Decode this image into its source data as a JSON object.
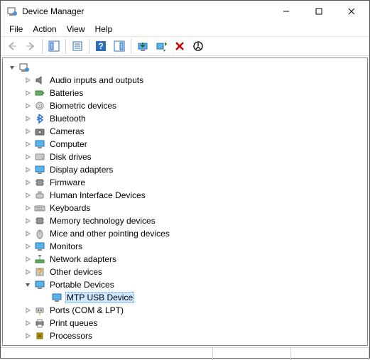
{
  "window": {
    "title": "Device Manager"
  },
  "menubar": [
    "File",
    "Action",
    "View",
    "Help"
  ],
  "tree": {
    "root": {
      "label": "",
      "expanded": true
    },
    "categories": [
      {
        "label": "Audio inputs and outputs",
        "icon": "speaker"
      },
      {
        "label": "Batteries",
        "icon": "battery"
      },
      {
        "label": "Biometric devices",
        "icon": "fingerprint"
      },
      {
        "label": "Bluetooth",
        "icon": "bluetooth"
      },
      {
        "label": "Cameras",
        "icon": "camera"
      },
      {
        "label": "Computer",
        "icon": "monitor"
      },
      {
        "label": "Disk drives",
        "icon": "disk"
      },
      {
        "label": "Display adapters",
        "icon": "monitor"
      },
      {
        "label": "Firmware",
        "icon": "chip"
      },
      {
        "label": "Human Interface Devices",
        "icon": "hid"
      },
      {
        "label": "Keyboards",
        "icon": "keyboard"
      },
      {
        "label": "Memory technology devices",
        "icon": "chip"
      },
      {
        "label": "Mice and other pointing devices",
        "icon": "mouse"
      },
      {
        "label": "Monitors",
        "icon": "monitor"
      },
      {
        "label": "Network adapters",
        "icon": "network"
      },
      {
        "label": "Other devices",
        "icon": "unknown"
      },
      {
        "label": "Portable Devices",
        "icon": "monitor",
        "expanded": true,
        "children": [
          {
            "label": "MTP USB Device",
            "icon": "monitor",
            "selected": true
          }
        ]
      },
      {
        "label": "Ports (COM & LPT)",
        "icon": "port"
      },
      {
        "label": "Print queues",
        "icon": "printer"
      },
      {
        "label": "Processors",
        "icon": "cpu"
      }
    ]
  }
}
